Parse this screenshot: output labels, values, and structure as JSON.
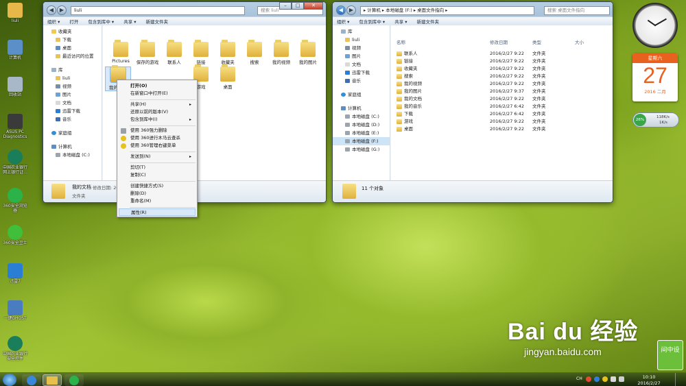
{
  "desktop_icons": [
    {
      "label": "liuli",
      "color": "#e6b84a"
    },
    {
      "label": "计算机",
      "color": "#5b8fc9"
    },
    {
      "label": "回收站",
      "color": "#a8b8c8"
    },
    {
      "label": "ASUS PC Diagnostics",
      "color": "#3a3a3a"
    },
    {
      "label": "中国农业银行网上银行证...",
      "color": "#1b7e5a"
    },
    {
      "label": "360安全浏览器",
      "color": "#2bb34a"
    },
    {
      "label": "360安全卫士",
      "color": "#3fbf3a"
    },
    {
      "label": "迅雷7",
      "color": "#2a7fd4"
    },
    {
      "label": "一键GHOST",
      "color": "#4a7cc0"
    },
    {
      "label": "中国农业银行安全控件",
      "color": "#1b7e5a"
    }
  ],
  "left_window": {
    "address": "liuli",
    "search_placeholder": "搜索 liuli",
    "toolbar": [
      "组织 ▾",
      "打开",
      "包含到库中 ▾",
      "共享 ▾",
      "新建文件夹"
    ],
    "nav": {
      "favorites": "收藏夹",
      "fav_items": [
        "下载",
        "桌面",
        "最近访问的位置"
      ],
      "libraries": "库",
      "lib_items": [
        "liuli",
        "视频",
        "图片",
        "文档",
        "迅雷下载",
        "音乐"
      ],
      "homegroup": "家庭组",
      "computer": "计算机",
      "drives": [
        "本地磁盘 (C:)"
      ]
    },
    "folders_row1": [
      "Pictures",
      "保存的游戏",
      "联系人",
      "链接",
      "收藏夹",
      "搜索",
      "我的视频",
      "我的图片"
    ],
    "folders_row2": [
      "我的文档",
      "",
      "",
      "游戏",
      "桌面"
    ],
    "details": {
      "name": "我的文档",
      "type": "文件夹",
      "modified": "修改日期: 20"
    }
  },
  "context_menu": {
    "items": [
      "打开(O)",
      "在新窗口中打开(E)",
      "共享(H)",
      "还原以前的版本(V)",
      "包含到库中(I)",
      "使用 360强力删除",
      "使用 360进行木马云查杀",
      "使用 360管理右键菜单",
      "发送到(N)",
      "剪切(T)",
      "复制(C)",
      "创建快捷方式(S)",
      "删除(D)",
      "重命名(M)",
      "属性(R)"
    ]
  },
  "right_window": {
    "address": "▸ 计算机 ▸ 本地磁盘 (F:) ▸ 桌面文件指向 ▸",
    "search_placeholder": "搜索 桌面文件指向",
    "toolbar": [
      "组织 ▾",
      "包含到库中 ▾",
      "共享 ▾",
      "新建文件夹"
    ],
    "columns": [
      "名称",
      "修改日期",
      "类型",
      "大小"
    ],
    "rows": [
      {
        "name": "联系人",
        "date": "2016/2/27 9:22",
        "type": "文件夹"
      },
      {
        "name": "链接",
        "date": "2016/2/27 9:22",
        "type": "文件夹"
      },
      {
        "name": "收藏夹",
        "date": "2016/2/27 9:22",
        "type": "文件夹"
      },
      {
        "name": "搜索",
        "date": "2016/2/27 9:22",
        "type": "文件夹"
      },
      {
        "name": "我的视频",
        "date": "2016/2/27 9:22",
        "type": "文件夹"
      },
      {
        "name": "我的图片",
        "date": "2016/2/27 9:37",
        "type": "文件夹"
      },
      {
        "name": "我的文档",
        "date": "2016/2/27 9:22",
        "type": "文件夹"
      },
      {
        "name": "我的音乐",
        "date": "2016/2/27 6:42",
        "type": "文件夹"
      },
      {
        "name": "下载",
        "date": "2016/2/27 6:42",
        "type": "文件夹"
      },
      {
        "name": "游戏",
        "date": "2016/2/27 9:22",
        "type": "文件夹"
      },
      {
        "name": "桌面",
        "date": "2016/2/27 9:22",
        "type": "文件夹"
      }
    ],
    "nav": {
      "libraries": "库",
      "lib_items": [
        "liuli",
        "视频",
        "图片",
        "文档",
        "迅雷下载",
        "音乐"
      ],
      "homegroup": "家庭组",
      "computer": "计算机",
      "drives": [
        "本地磁盘 (C:)",
        "本地磁盘 (D:)",
        "本地磁盘 (E:)",
        "本地磁盘 (F:)",
        "本地磁盘 (G:)"
      ]
    },
    "status": "11 个对象"
  },
  "gadgets": {
    "calendar_weekday": "星期六",
    "calendar_day": "27",
    "calendar_month": "2016 二月",
    "net_percent": "26%",
    "net_up": "118K/s",
    "net_down": "1K/s"
  },
  "taskbar": {
    "time": "10:10",
    "date": "2016/2/27",
    "lang": "CH"
  },
  "watermark": {
    "brand": "Bai du 经验",
    "url": "jingyan.baidu.com",
    "badge": "间中设"
  }
}
